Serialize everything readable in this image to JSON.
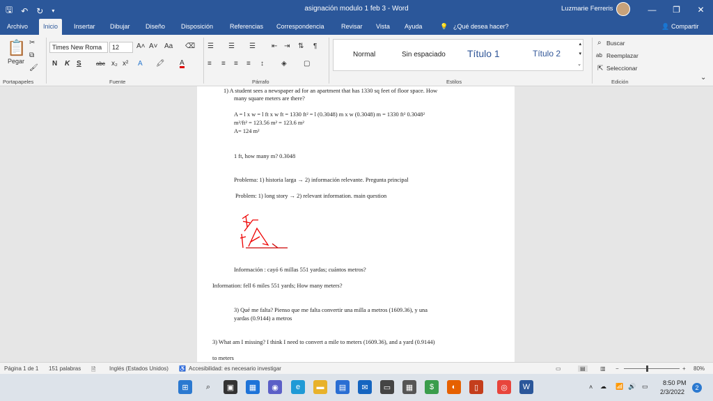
{
  "window": {
    "title": "asignación modulo 1 feb 3  -  Word",
    "user": "Luzmarie Ferreris"
  },
  "tabs": [
    "Archivo",
    "Inicio",
    "Insertar",
    "Dibujar",
    "Diseño",
    "Disposición",
    "Referencias",
    "Correspondencia",
    "Revisar",
    "Vista",
    "Ayuda"
  ],
  "tell_me": "¿Qué desea hacer?",
  "share": "Compartir",
  "ribbon": {
    "paste": "Pegar",
    "font_name": "Times New Roma",
    "font_size": "12",
    "bold": "N",
    "italic": "K",
    "underline": "S",
    "strike": "abc",
    "subscript": "x₂",
    "superscript": "x²",
    "groups": {
      "clipboard": "Portapapeles",
      "font": "Fuente",
      "paragraph": "Párrafo",
      "styles": "Estilos",
      "editing": "Edición"
    },
    "styles": [
      "Normal",
      "Sin espaciado",
      "Título 1",
      "Título 2"
    ],
    "editing": [
      "Buscar",
      "Reemplazar",
      "Seleccionar"
    ]
  },
  "document": {
    "lines": [
      "1)   A student sees a newspaper ad for an apartment that has 1330 sq feet of floor space. How",
      "many square meters are there?",
      "A = l x w  = l ft x w ft = 1330 ft² =  l (0.3048) m  x w (0.3048) m = 1330 ft² 0.3048²",
      "m²/ft² = 123.56 m² = 123.6 m²",
      "A= 124 m²",
      "1 ft, how many m? 0.3048",
      "Problema: 1) historia larga → 2) información relevante.   Pregunta principal",
      "Problem: 1) long story → 2) relevant information. main question",
      "Información : cayó 6 millas 551 yardas;  cuántos metros?",
      "Information: fell 6 miles 551 yards; How many meters?",
      "3) Qué me falta?   Pienso que me falta convertir una milla a metros (1609.36), y una",
      "yardas (0.9144) a metros",
      "3) What am I missing? I think I need to convert a mile to meters (1609.36), and a yard (0.9144)",
      "to meters"
    ]
  },
  "status": {
    "page": "Página 1 de 1",
    "words": "151 palabras",
    "language": "Inglés (Estados Unidos)",
    "accessibility": "Accesibilidad: es necesario investigar",
    "zoom": "80%"
  },
  "clock": {
    "time": "8:50 PM",
    "date": "2/3/2022",
    "notifications": "2"
  }
}
